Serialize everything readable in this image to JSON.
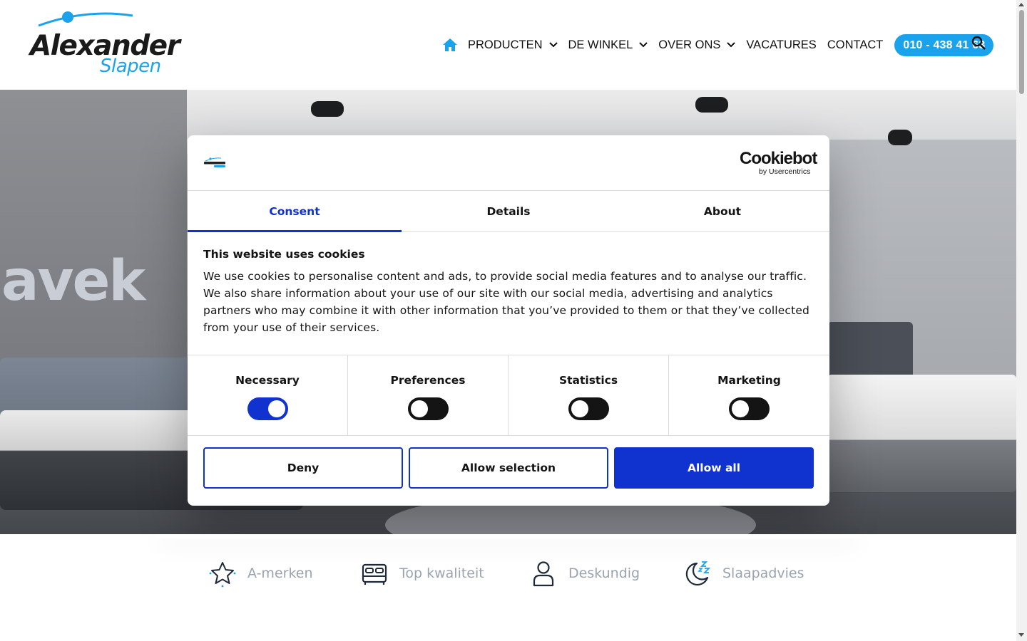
{
  "header": {
    "logo": {
      "main": "Alexander",
      "sub": "Slapen"
    },
    "nav": [
      {
        "label": "PRODUCTEN",
        "dropdown": true
      },
      {
        "label": "DE WINKEL",
        "dropdown": true
      },
      {
        "label": "OVER ONS",
        "dropdown": true
      },
      {
        "label": "VACATURES",
        "dropdown": false
      },
      {
        "label": "CONTACT",
        "dropdown": false
      }
    ],
    "phone": "010 - 438 41 63",
    "icons": {
      "home": "home-icon",
      "search": "search-icon",
      "chevron": "chevron-down-icon"
    }
  },
  "hero": {
    "brand_text": "avek"
  },
  "cookie_dialog": {
    "brand": {
      "name": "Cookiebot",
      "byline": "by Usercentrics"
    },
    "tabs": [
      {
        "label": "Consent",
        "active": true
      },
      {
        "label": "Details",
        "active": false
      },
      {
        "label": "About",
        "active": false
      }
    ],
    "title": "This website uses cookies",
    "text": "We use cookies to personalise content and ads, to provide social media features and to analyse our traffic. We also share information about your use of our site with our social media, advertising and analytics partners who may combine it with other information that you’ve provided to them or that they’ve collected from your use of their services.",
    "categories": [
      {
        "label": "Necessary",
        "enabled": true
      },
      {
        "label": "Preferences",
        "enabled": false
      },
      {
        "label": "Statistics",
        "enabled": false
      },
      {
        "label": "Marketing",
        "enabled": false
      }
    ],
    "buttons": {
      "deny": "Deny",
      "allow_selection": "Allow selection",
      "allow_all": "Allow all"
    }
  },
  "features": [
    {
      "label": "A-merken",
      "icon": "star-icon"
    },
    {
      "label": "Top kwaliteit",
      "icon": "bed-icon"
    },
    {
      "label": "Deskundig",
      "icon": "person-icon"
    },
    {
      "label": "Slaapadvies",
      "icon": "moon-sleep-icon"
    }
  ],
  "colors": {
    "brand_blue": "#1aa3ec",
    "cookiebot_blue": "#1032cf",
    "text_dark": "#141414",
    "feature_text": "#9aa3b0",
    "feature_icon": "#1e2a3a"
  }
}
